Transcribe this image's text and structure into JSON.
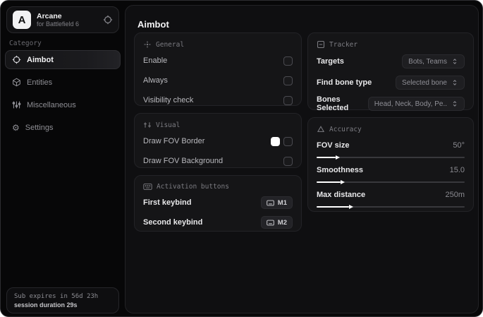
{
  "app": {
    "name": "Arcane",
    "subtitle": "for Battlefield 6",
    "logo_letter": "A"
  },
  "sidebar": {
    "category_label": "Category",
    "items": [
      {
        "label": "Aimbot",
        "icon": "crosshair-icon",
        "active": true
      },
      {
        "label": "Entities",
        "icon": "cube-icon",
        "active": false
      },
      {
        "label": "Miscellaneous",
        "icon": "sliders-icon",
        "active": false
      },
      {
        "label": "Settings",
        "icon": "gear-icon",
        "active": false
      }
    ],
    "footer": {
      "line1": "Sub expires in 56d 23h",
      "line2": "session duration 29s"
    }
  },
  "main": {
    "title": "Aimbot",
    "general": {
      "title": "General",
      "rows": [
        {
          "label": "Enable",
          "checked": false
        },
        {
          "label": "Always",
          "checked": false
        },
        {
          "label": "Visibility check",
          "checked": false
        }
      ]
    },
    "visual": {
      "title": "Visual",
      "rows": [
        {
          "label": "Draw FOV Border",
          "swatch": "#ffffff",
          "checked": false
        },
        {
          "label": "Draw FOV Background",
          "checked": false
        }
      ]
    },
    "activation": {
      "title": "Activation buttons",
      "rows": [
        {
          "label": "First keybind",
          "key": "M1"
        },
        {
          "label": "Second keybind",
          "key": "M2"
        }
      ]
    },
    "tracker": {
      "title": "Tracker",
      "rows": [
        {
          "label": "Targets",
          "value": "Bots, Teams"
        },
        {
          "label": "Find bone type",
          "value": "Selected bone"
        },
        {
          "label": "Bones Selected",
          "value": "Head, Neck, Body, Pe.."
        }
      ]
    },
    "accuracy": {
      "title": "Accuracy",
      "sliders": [
        {
          "label": "FOV size",
          "value": "50°",
          "percent": 13
        },
        {
          "label": "Smoothness",
          "value": "15.0",
          "percent": 16
        },
        {
          "label": "Max distance",
          "value": "250m",
          "percent": 22
        }
      ]
    }
  }
}
